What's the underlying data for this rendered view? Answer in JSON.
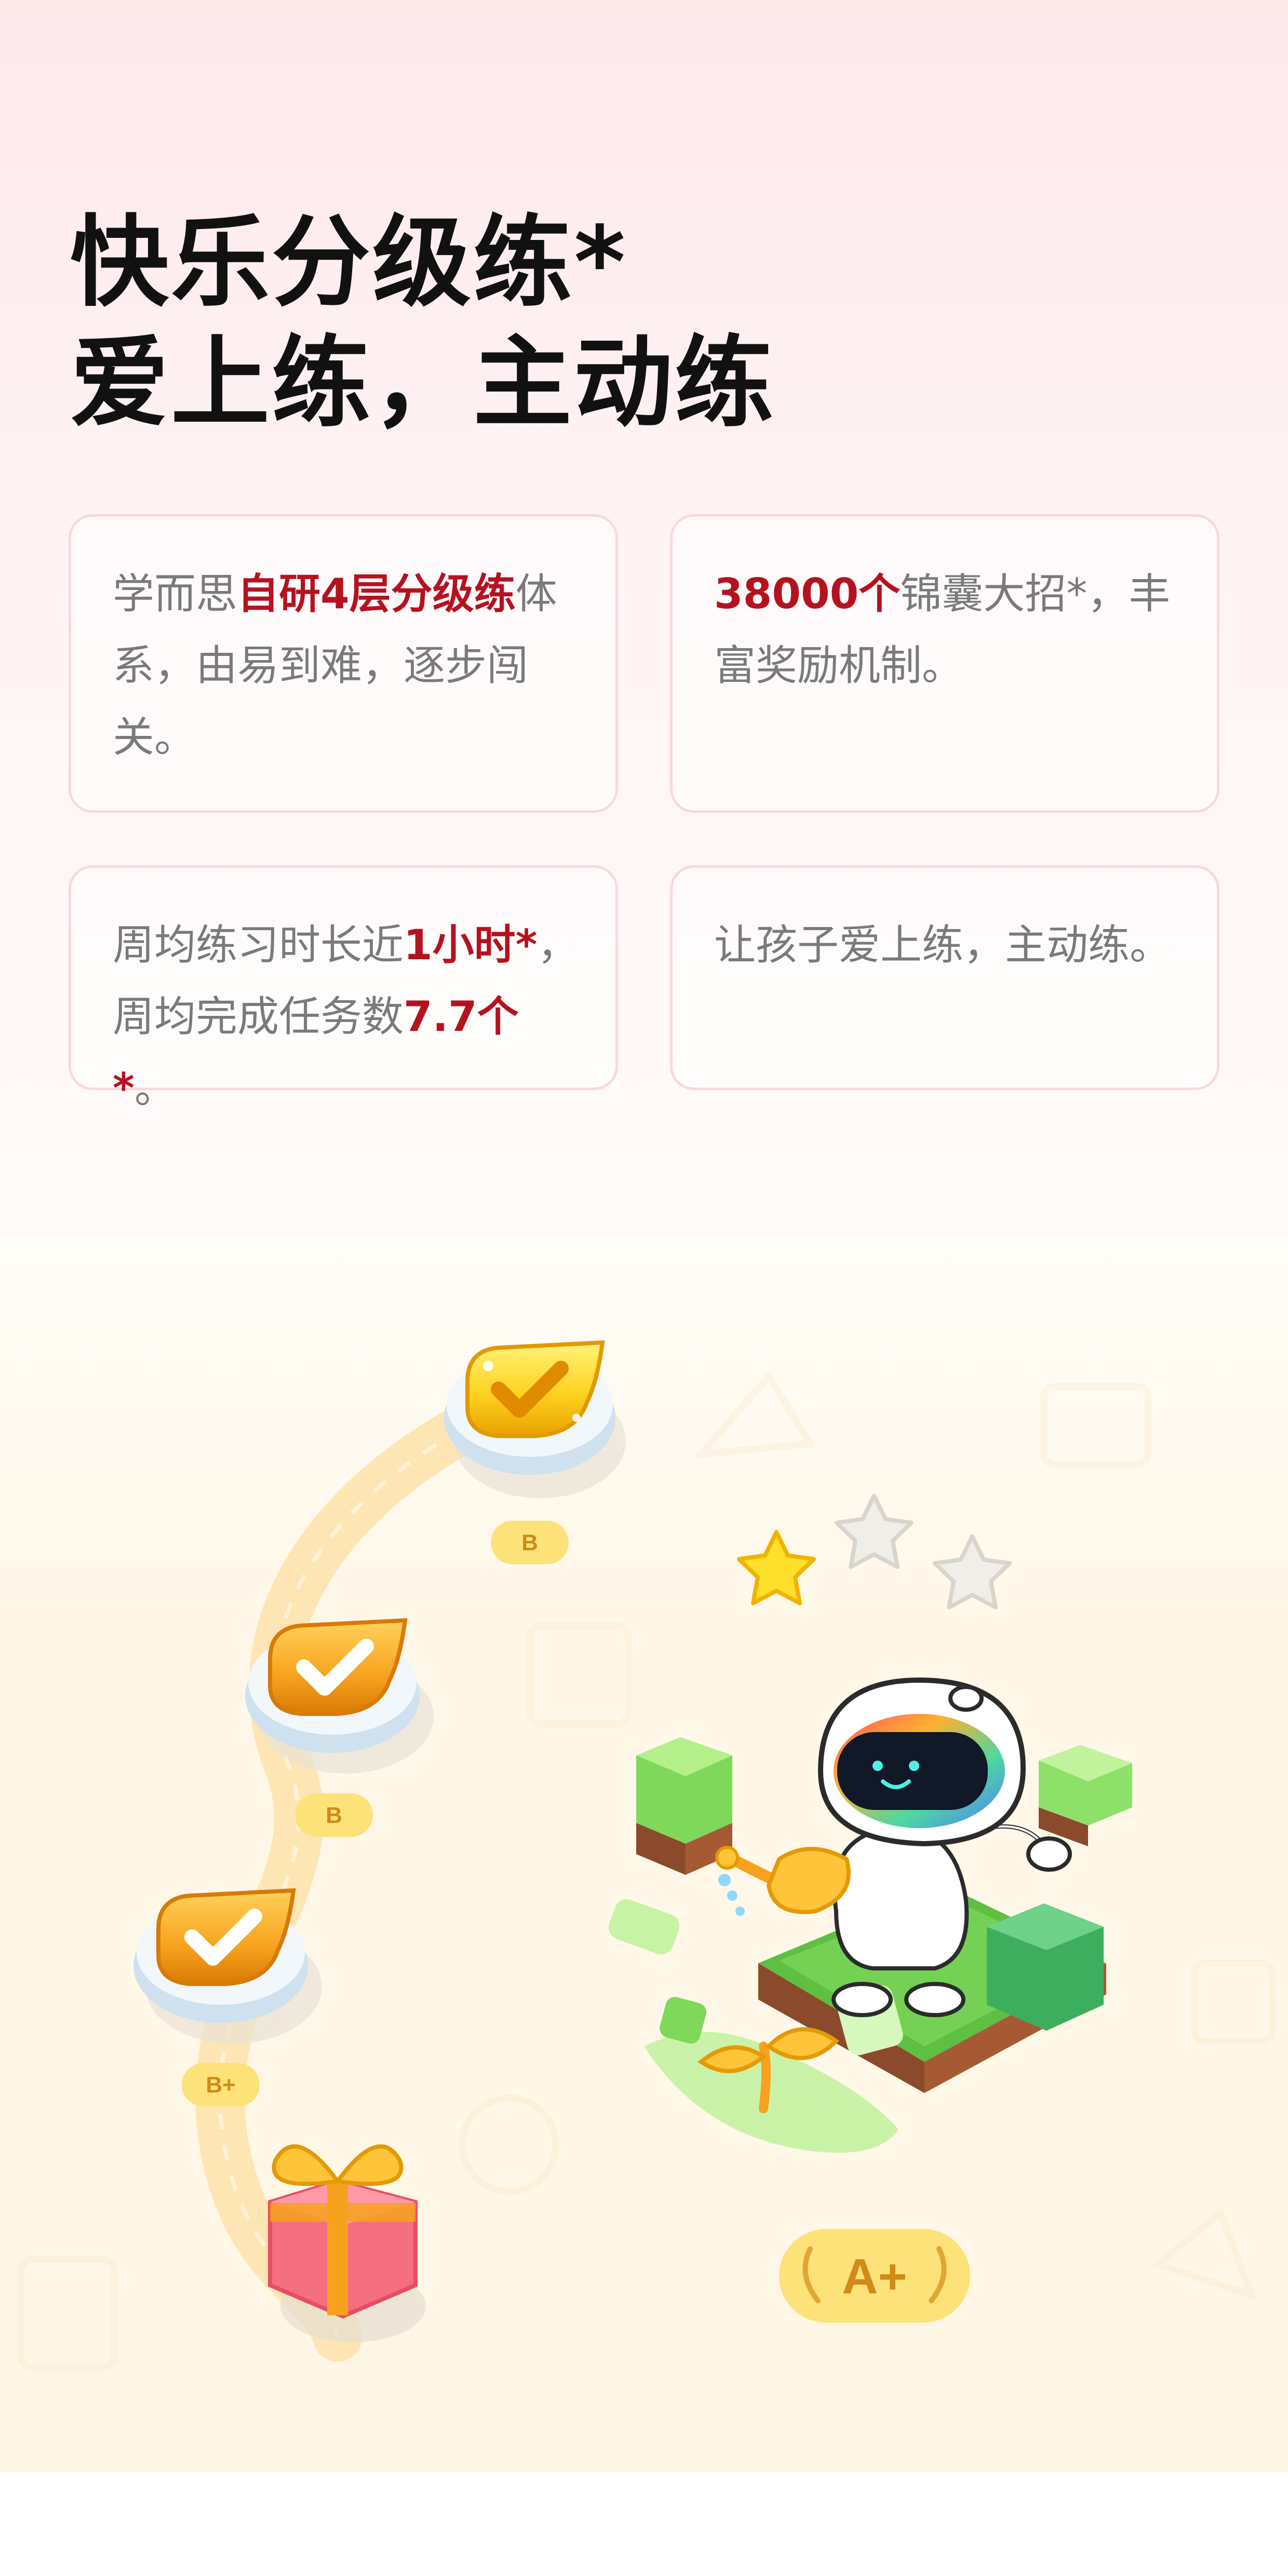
{
  "header": {
    "title_line1": "快乐分级练*",
    "title_line2": "爱上练，主动练"
  },
  "cards": [
    {
      "pre": "学而思",
      "highlight": "自研4层分级练",
      "post": "体系，由易到难，逐步闯关。"
    },
    {
      "pre": "",
      "highlight": "38000个",
      "post": "锦囊大招*，丰富奖励机制。"
    },
    {
      "pre": "周均练习时长近",
      "highlight": "1小时*",
      "mid": "，周均完成任务数",
      "highlight2": "7.7个*",
      "post": "。"
    },
    {
      "pre": "",
      "highlight": "",
      "post": "让孩子爱上练，主动练。"
    }
  ],
  "illustration": {
    "level_badges": [
      "B",
      "B",
      "B+"
    ],
    "grade_badge": "A+",
    "stars_earned": 1,
    "stars_total": 3
  },
  "colors": {
    "accent": "#b5121f",
    "body_text": "#7a7a7a",
    "title_text": "#111111",
    "card_border": "#f7d9dd",
    "badge_fill": "#fde27a",
    "badge_text": "#d08a17",
    "grass": "#6fcd4c"
  }
}
